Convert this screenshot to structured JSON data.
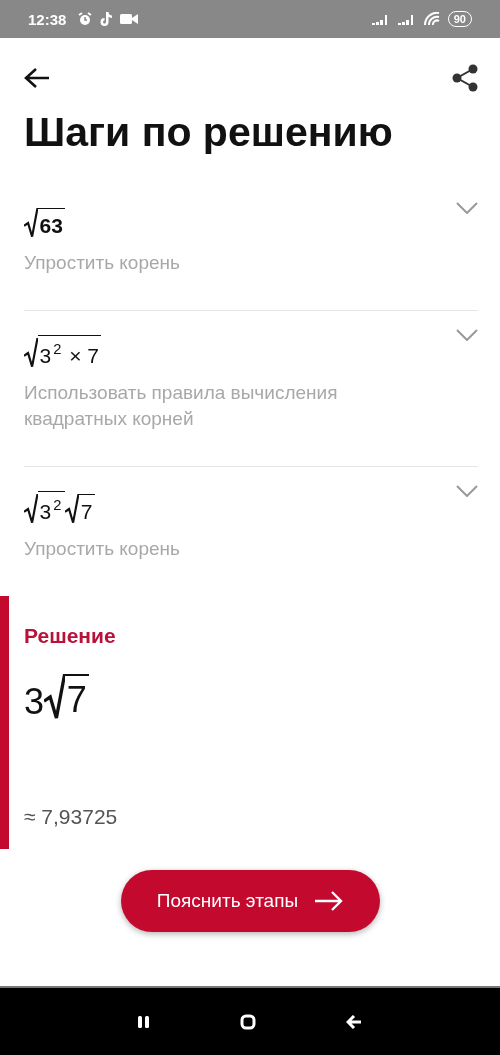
{
  "status_bar": {
    "time": "12:38",
    "battery": "90"
  },
  "title": "Шаги по решению",
  "steps": [
    {
      "expression": [
        {
          "kind": "sqrt",
          "text": "**63**"
        }
      ],
      "description": "Упростить корень",
      "expanded": false
    },
    {
      "expression": [
        {
          "kind": "sqrt",
          "text": "3$^{2}$ × 7"
        }
      ],
      "description": "Использовать правила вычисления квадратных корней",
      "expanded": false
    },
    {
      "expression": [
        {
          "kind": "sqrt",
          "text": "3$^{2}$"
        },
        {
          "kind": "sqrt",
          "text": "7"
        }
      ],
      "description": "Упростить корень",
      "expanded": false
    }
  ],
  "solution": {
    "heading": "Решение",
    "expression": [
      {
        "kind": "plain",
        "text": "3"
      },
      {
        "kind": "sqrt",
        "text": "7"
      }
    ],
    "approximation": "≈ 7,93725"
  },
  "button": "Пояснить этапы"
}
